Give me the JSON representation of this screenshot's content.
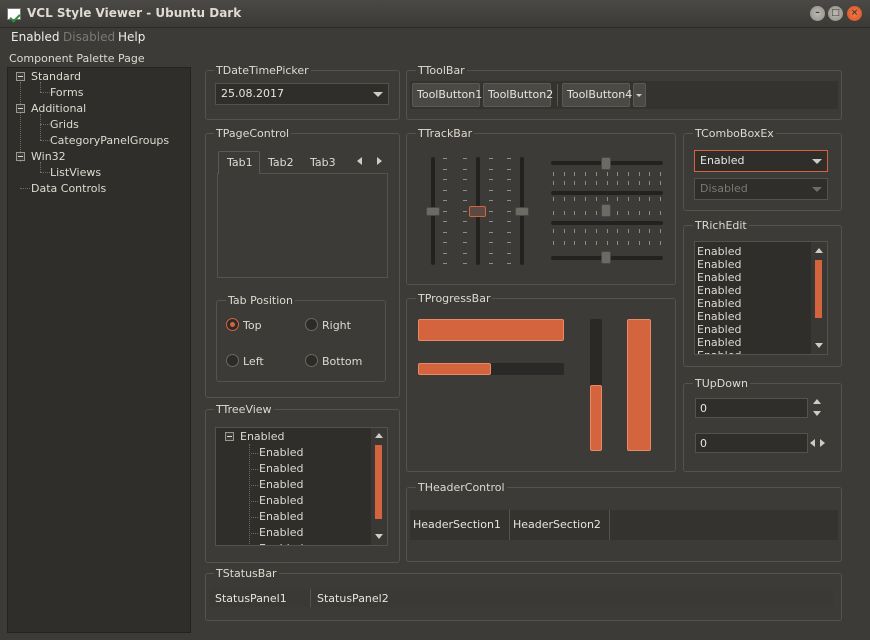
{
  "window": {
    "title": "VCL Style Viewer - Ubuntu Dark",
    "minimize_glyph": "–",
    "maximize_glyph": "□",
    "close_glyph": "×"
  },
  "menu": {
    "items": [
      "Enabled",
      "Disabled",
      "Help"
    ]
  },
  "left_panel": {
    "caption": "Component Palette Page",
    "tree": [
      "Standard",
      "Forms",
      "Additional",
      "Grids",
      "CategoryPanelGroups",
      "Win32",
      "ListViews",
      "Data Controls"
    ]
  },
  "datetimepicker": {
    "title": "TDateTimePicker",
    "value": "25.08.2017"
  },
  "toolbar": {
    "title": "TToolBar",
    "buttons": [
      "ToolButton1",
      "ToolButton2",
      "ToolButton4"
    ]
  },
  "pagecontrol": {
    "title": "TPageControl",
    "tabs": [
      "Tab1",
      "Tab2",
      "Tab3"
    ],
    "active_tab": "Tab1"
  },
  "tab_position": {
    "title": "Tab Position",
    "options": [
      "Top",
      "Right",
      "Left",
      "Bottom"
    ],
    "selected": "Top"
  },
  "trackbar": {
    "title": "TTrackBar"
  },
  "comboboxex": {
    "title": "TComboBoxEx",
    "enabled_value": "Enabled",
    "disabled_value": "Disabled"
  },
  "richedit": {
    "title": "TRichEdit",
    "lines": [
      "Enabled",
      "Enabled",
      "Enabled",
      "Enabled",
      "Enabled",
      "Enabled",
      "Enabled",
      "Enabled",
      "Enabled",
      "Enabled"
    ]
  },
  "progressbar": {
    "title": "TProgressBar",
    "horizontal_values": [
      1.0,
      0.5
    ],
    "vertical_values": [
      0.5,
      1.0
    ]
  },
  "updown": {
    "title": "TUpDown",
    "values": [
      "0",
      "0"
    ]
  },
  "treeview": {
    "title": "TTreeView",
    "root": "Enabled",
    "children": [
      "Enabled",
      "Enabled",
      "Enabled",
      "Enabled",
      "Enabled",
      "Enabled",
      "Enabled"
    ]
  },
  "headercontrol": {
    "title": "THeaderControl",
    "sections": [
      "HeaderSection1",
      "HeaderSection2"
    ]
  },
  "statusbar": {
    "title": "TStatusBar",
    "panels": [
      "StatusPanel1",
      "StatusPanel2"
    ]
  },
  "colors": {
    "accent": "#d4643e",
    "background": "#3c3b37",
    "field": "#2f2e2b"
  }
}
